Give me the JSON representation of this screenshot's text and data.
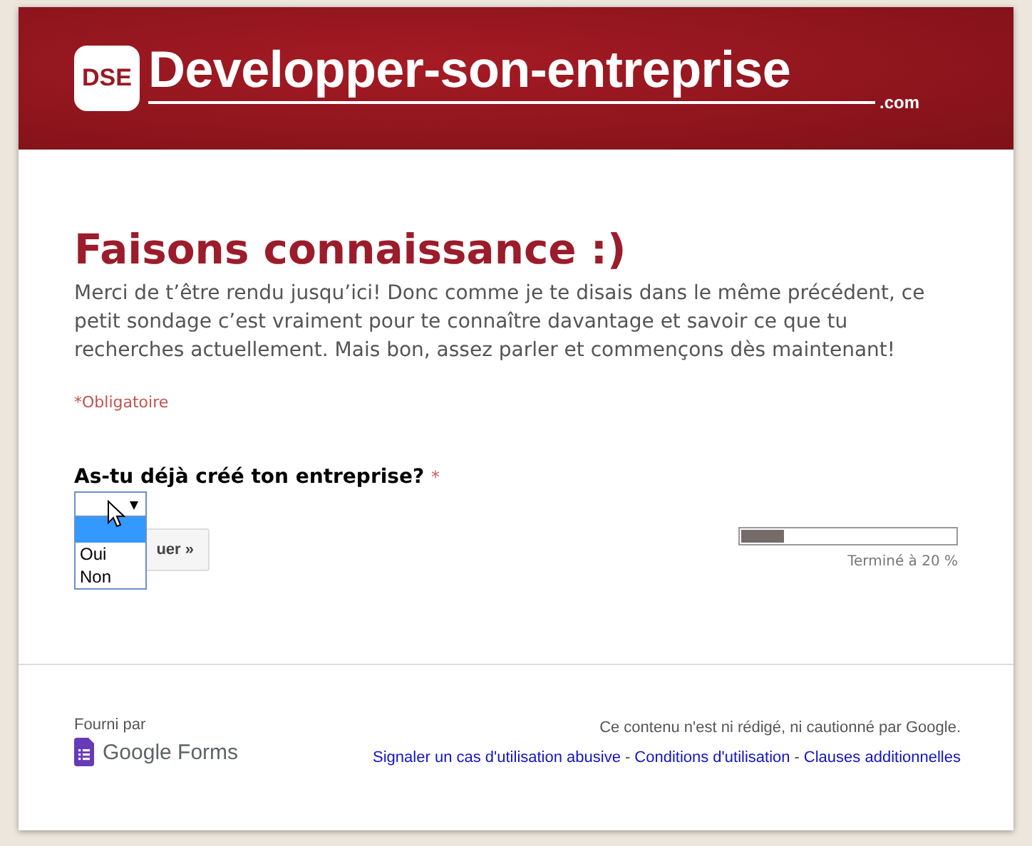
{
  "header": {
    "badge": "DSE",
    "name": "Developper-son-entreprise",
    "domain": ".com"
  },
  "form": {
    "title": "Faisons connaissance :)",
    "description": "Merci de t’être rendu jusqu’ici! Donc comme je te disais dans le même précédent, ce petit sondage c’est vraiment pour te connaître davantage et savoir ce que tu recherches actuellement. Mais bon, assez parler et commençons dès maintenant!",
    "required_note": "*Obligatoire",
    "question": {
      "label": "As-tu déjà créé ton entreprise?",
      "required_mark": "*",
      "dropdown": {
        "open": true,
        "options": [
          {
            "selected": true
          },
          {
            "label": "Oui",
            "selected": false
          },
          {
            "label": "Non",
            "selected": false
          }
        ]
      }
    },
    "continue_button": {
      "label": "uer »"
    },
    "progress": {
      "level": 0.2,
      "label": "Terminé à 20 %"
    }
  },
  "footer": {
    "provided_by": "Fourni par",
    "brand": "Google Forms",
    "disclaimer": "Ce contenu n'est ni rédigé, ni cautionné par Google.",
    "links": [
      "Signaler un cas d'utilisation abusive",
      "Conditions d'utilisation",
      "Clauses additionnelles"
    ],
    "separator": "-"
  }
}
